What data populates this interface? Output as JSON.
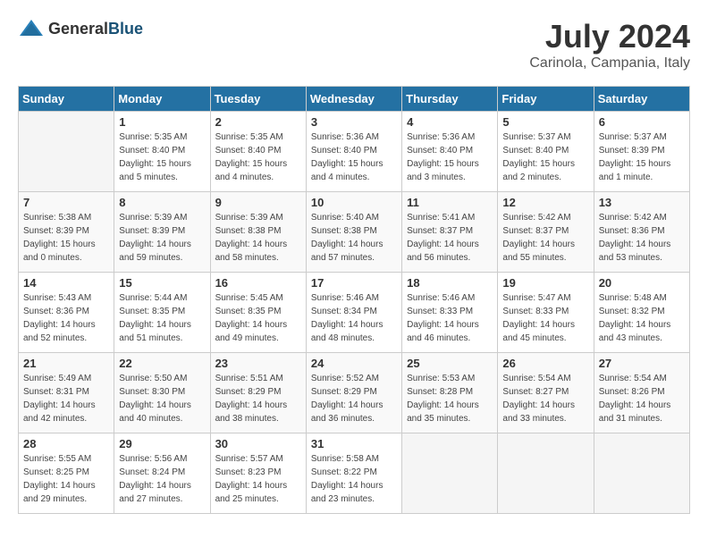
{
  "header": {
    "logo_general": "General",
    "logo_blue": "Blue",
    "month_year": "July 2024",
    "location": "Carinola, Campania, Italy"
  },
  "calendar": {
    "days_of_week": [
      "Sunday",
      "Monday",
      "Tuesday",
      "Wednesday",
      "Thursday",
      "Friday",
      "Saturday"
    ],
    "weeks": [
      [
        {
          "day": "",
          "info": ""
        },
        {
          "day": "1",
          "info": "Sunrise: 5:35 AM\nSunset: 8:40 PM\nDaylight: 15 hours\nand 5 minutes."
        },
        {
          "day": "2",
          "info": "Sunrise: 5:35 AM\nSunset: 8:40 PM\nDaylight: 15 hours\nand 4 minutes."
        },
        {
          "day": "3",
          "info": "Sunrise: 5:36 AM\nSunset: 8:40 PM\nDaylight: 15 hours\nand 4 minutes."
        },
        {
          "day": "4",
          "info": "Sunrise: 5:36 AM\nSunset: 8:40 PM\nDaylight: 15 hours\nand 3 minutes."
        },
        {
          "day": "5",
          "info": "Sunrise: 5:37 AM\nSunset: 8:40 PM\nDaylight: 15 hours\nand 2 minutes."
        },
        {
          "day": "6",
          "info": "Sunrise: 5:37 AM\nSunset: 8:39 PM\nDaylight: 15 hours\nand 1 minute."
        }
      ],
      [
        {
          "day": "7",
          "info": "Sunrise: 5:38 AM\nSunset: 8:39 PM\nDaylight: 15 hours\nand 0 minutes."
        },
        {
          "day": "8",
          "info": "Sunrise: 5:39 AM\nSunset: 8:39 PM\nDaylight: 14 hours\nand 59 minutes."
        },
        {
          "day": "9",
          "info": "Sunrise: 5:39 AM\nSunset: 8:38 PM\nDaylight: 14 hours\nand 58 minutes."
        },
        {
          "day": "10",
          "info": "Sunrise: 5:40 AM\nSunset: 8:38 PM\nDaylight: 14 hours\nand 57 minutes."
        },
        {
          "day": "11",
          "info": "Sunrise: 5:41 AM\nSunset: 8:37 PM\nDaylight: 14 hours\nand 56 minutes."
        },
        {
          "day": "12",
          "info": "Sunrise: 5:42 AM\nSunset: 8:37 PM\nDaylight: 14 hours\nand 55 minutes."
        },
        {
          "day": "13",
          "info": "Sunrise: 5:42 AM\nSunset: 8:36 PM\nDaylight: 14 hours\nand 53 minutes."
        }
      ],
      [
        {
          "day": "14",
          "info": "Sunrise: 5:43 AM\nSunset: 8:36 PM\nDaylight: 14 hours\nand 52 minutes."
        },
        {
          "day": "15",
          "info": "Sunrise: 5:44 AM\nSunset: 8:35 PM\nDaylight: 14 hours\nand 51 minutes."
        },
        {
          "day": "16",
          "info": "Sunrise: 5:45 AM\nSunset: 8:35 PM\nDaylight: 14 hours\nand 49 minutes."
        },
        {
          "day": "17",
          "info": "Sunrise: 5:46 AM\nSunset: 8:34 PM\nDaylight: 14 hours\nand 48 minutes."
        },
        {
          "day": "18",
          "info": "Sunrise: 5:46 AM\nSunset: 8:33 PM\nDaylight: 14 hours\nand 46 minutes."
        },
        {
          "day": "19",
          "info": "Sunrise: 5:47 AM\nSunset: 8:33 PM\nDaylight: 14 hours\nand 45 minutes."
        },
        {
          "day": "20",
          "info": "Sunrise: 5:48 AM\nSunset: 8:32 PM\nDaylight: 14 hours\nand 43 minutes."
        }
      ],
      [
        {
          "day": "21",
          "info": "Sunrise: 5:49 AM\nSunset: 8:31 PM\nDaylight: 14 hours\nand 42 minutes."
        },
        {
          "day": "22",
          "info": "Sunrise: 5:50 AM\nSunset: 8:30 PM\nDaylight: 14 hours\nand 40 minutes."
        },
        {
          "day": "23",
          "info": "Sunrise: 5:51 AM\nSunset: 8:29 PM\nDaylight: 14 hours\nand 38 minutes."
        },
        {
          "day": "24",
          "info": "Sunrise: 5:52 AM\nSunset: 8:29 PM\nDaylight: 14 hours\nand 36 minutes."
        },
        {
          "day": "25",
          "info": "Sunrise: 5:53 AM\nSunset: 8:28 PM\nDaylight: 14 hours\nand 35 minutes."
        },
        {
          "day": "26",
          "info": "Sunrise: 5:54 AM\nSunset: 8:27 PM\nDaylight: 14 hours\nand 33 minutes."
        },
        {
          "day": "27",
          "info": "Sunrise: 5:54 AM\nSunset: 8:26 PM\nDaylight: 14 hours\nand 31 minutes."
        }
      ],
      [
        {
          "day": "28",
          "info": "Sunrise: 5:55 AM\nSunset: 8:25 PM\nDaylight: 14 hours\nand 29 minutes."
        },
        {
          "day": "29",
          "info": "Sunrise: 5:56 AM\nSunset: 8:24 PM\nDaylight: 14 hours\nand 27 minutes."
        },
        {
          "day": "30",
          "info": "Sunrise: 5:57 AM\nSunset: 8:23 PM\nDaylight: 14 hours\nand 25 minutes."
        },
        {
          "day": "31",
          "info": "Sunrise: 5:58 AM\nSunset: 8:22 PM\nDaylight: 14 hours\nand 23 minutes."
        },
        {
          "day": "",
          "info": ""
        },
        {
          "day": "",
          "info": ""
        },
        {
          "day": "",
          "info": ""
        }
      ]
    ]
  }
}
